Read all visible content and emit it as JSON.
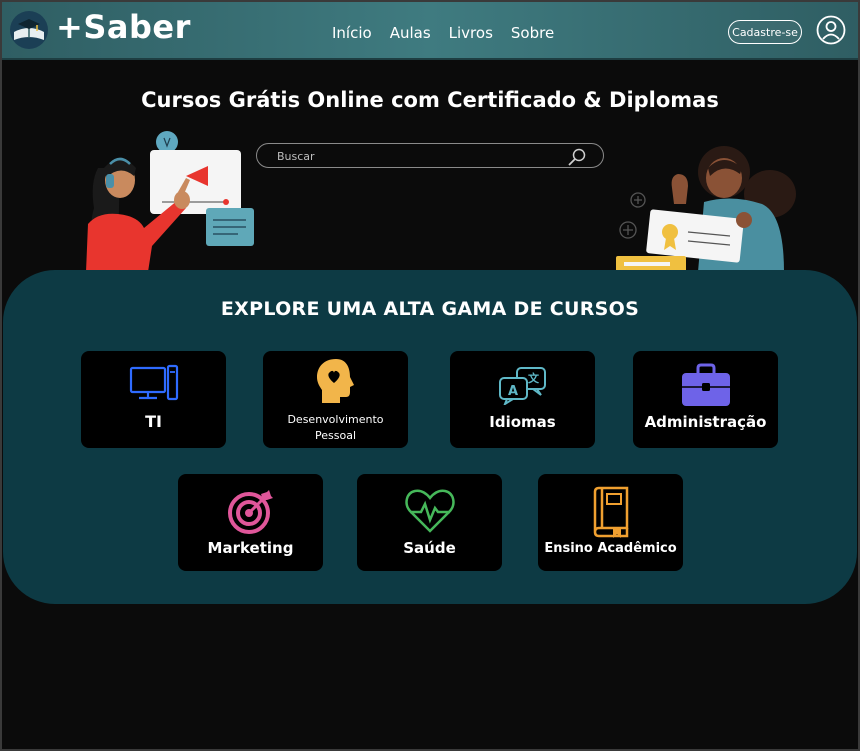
{
  "header": {
    "logo_text": "+Saber",
    "nav": [
      "Início",
      "Aulas",
      "Livros",
      "Sobre"
    ],
    "signup_label": "Cadastre-se"
  },
  "hero": {
    "title": "Cursos Grátis Online com Certificado & Diplomas",
    "search_placeholder": "Buscar"
  },
  "explore": {
    "title": "EXPLORE UMA ALTA GAMA DE CURSOS",
    "categories": [
      {
        "label": "TI",
        "icon": "computer-icon",
        "color": "#2f6bff"
      },
      {
        "label": "Desenvolvimento Pessoal",
        "icon": "head-heart-icon",
        "color": "#f2b54a"
      },
      {
        "label": "Idiomas",
        "icon": "translate-icon",
        "color": "#5fb8c7"
      },
      {
        "label": "Administração",
        "icon": "briefcase-icon",
        "color": "#6e63e8"
      },
      {
        "label": "Marketing",
        "icon": "target-icon",
        "color": "#e0569a"
      },
      {
        "label": "Saúde",
        "icon": "heartbeat-icon",
        "color": "#46b85a"
      },
      {
        "label": "Ensino Acadêmico",
        "icon": "book-icon",
        "color": "#f0a030"
      }
    ]
  },
  "colors": {
    "header": "#3f7b80",
    "panel": "#0d3a44",
    "background": "#0b0b0b"
  }
}
